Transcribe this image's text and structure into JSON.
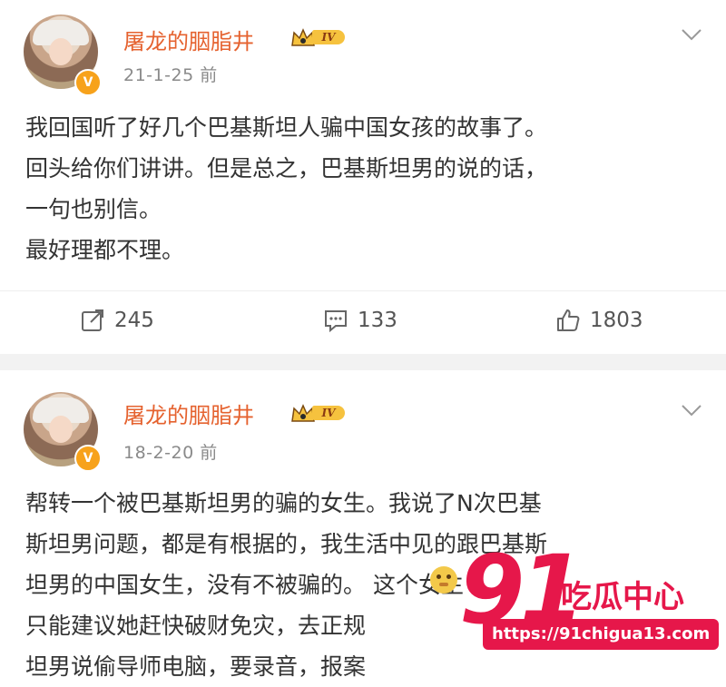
{
  "colors": {
    "name": "#e5622f",
    "accent": "#f7a21b",
    "watermark": "#e6174a"
  },
  "posts": [
    {
      "author": "屠龙的胭脂井",
      "level": "IV",
      "time": "21-1-25 前",
      "content": "我回国听了好几个巴基斯坦人骗中国女孩的故事了。\n回头给你们讲讲。但是总之，巴基斯坦男的说的话，\n一句也别信。\n最好理都不理。",
      "repost_count": "245",
      "comment_count": "133",
      "like_count": "1803"
    },
    {
      "author": "屠龙的胭脂井",
      "level": "IV",
      "time": "18-2-20 前",
      "content": "帮转一个被巴基斯坦男的骗的女生。我说了N次巴基\n斯坦男问题，都是有根据的，我生活中见的跟巴基斯\n坦男的中国女生，没有不被骗的。 这个女生\n只能建议她赶快破财免灾，去正规\n坦男说偷导师电脑，要录音，报案"
    }
  ],
  "watermark": {
    "number": "91",
    "brand": "吃瓜中心",
    "url": "https://91chigua13.com"
  }
}
